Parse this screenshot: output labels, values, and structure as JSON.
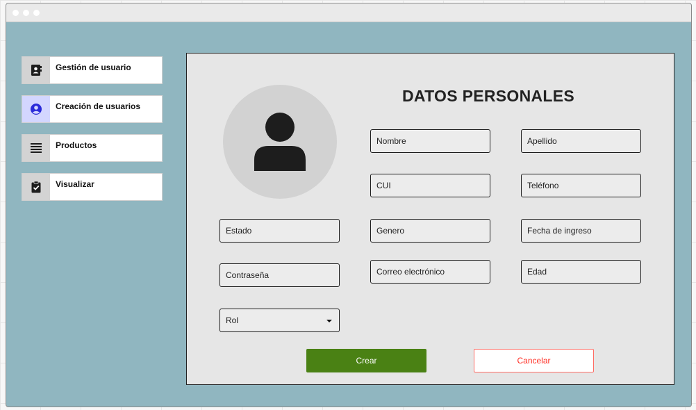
{
  "window": {
    "control_icons": [
      "dot-icon",
      "dot-icon",
      "dot-icon"
    ]
  },
  "sidebar": {
    "items": [
      {
        "label": "Gestión de usuario",
        "icon": "contact-book-icon",
        "active": false
      },
      {
        "label": "Creación de usuarios",
        "icon": "user-circle-icon",
        "active": true
      },
      {
        "label": "Productos",
        "icon": "list-icon",
        "active": false
      },
      {
        "label": "Visualizar",
        "icon": "clipboard-check-icon",
        "active": false
      }
    ]
  },
  "form": {
    "title": "DATOS PERSONALES",
    "avatar_icon": "user-avatar-icon",
    "fields": {
      "nombre": "Nombre",
      "apellido": "Apellido",
      "cui": "CUI",
      "telefono": "Teléfono",
      "estado": "Estado",
      "genero": "Genero",
      "fecha_ingreso": "Fecha de ingreso",
      "contrasena": "Contraseña",
      "correo": "Correo electrónico",
      "edad": "Edad",
      "rol": "Rol"
    },
    "buttons": {
      "create": "Crear",
      "cancel": "Cancelar"
    }
  },
  "colors": {
    "background": "#90b6c0",
    "panel": "#e6e6e6",
    "create_button": "#4a8114",
    "cancel_text": "#ff2a1f",
    "active_icon": "#2b2bd9"
  }
}
